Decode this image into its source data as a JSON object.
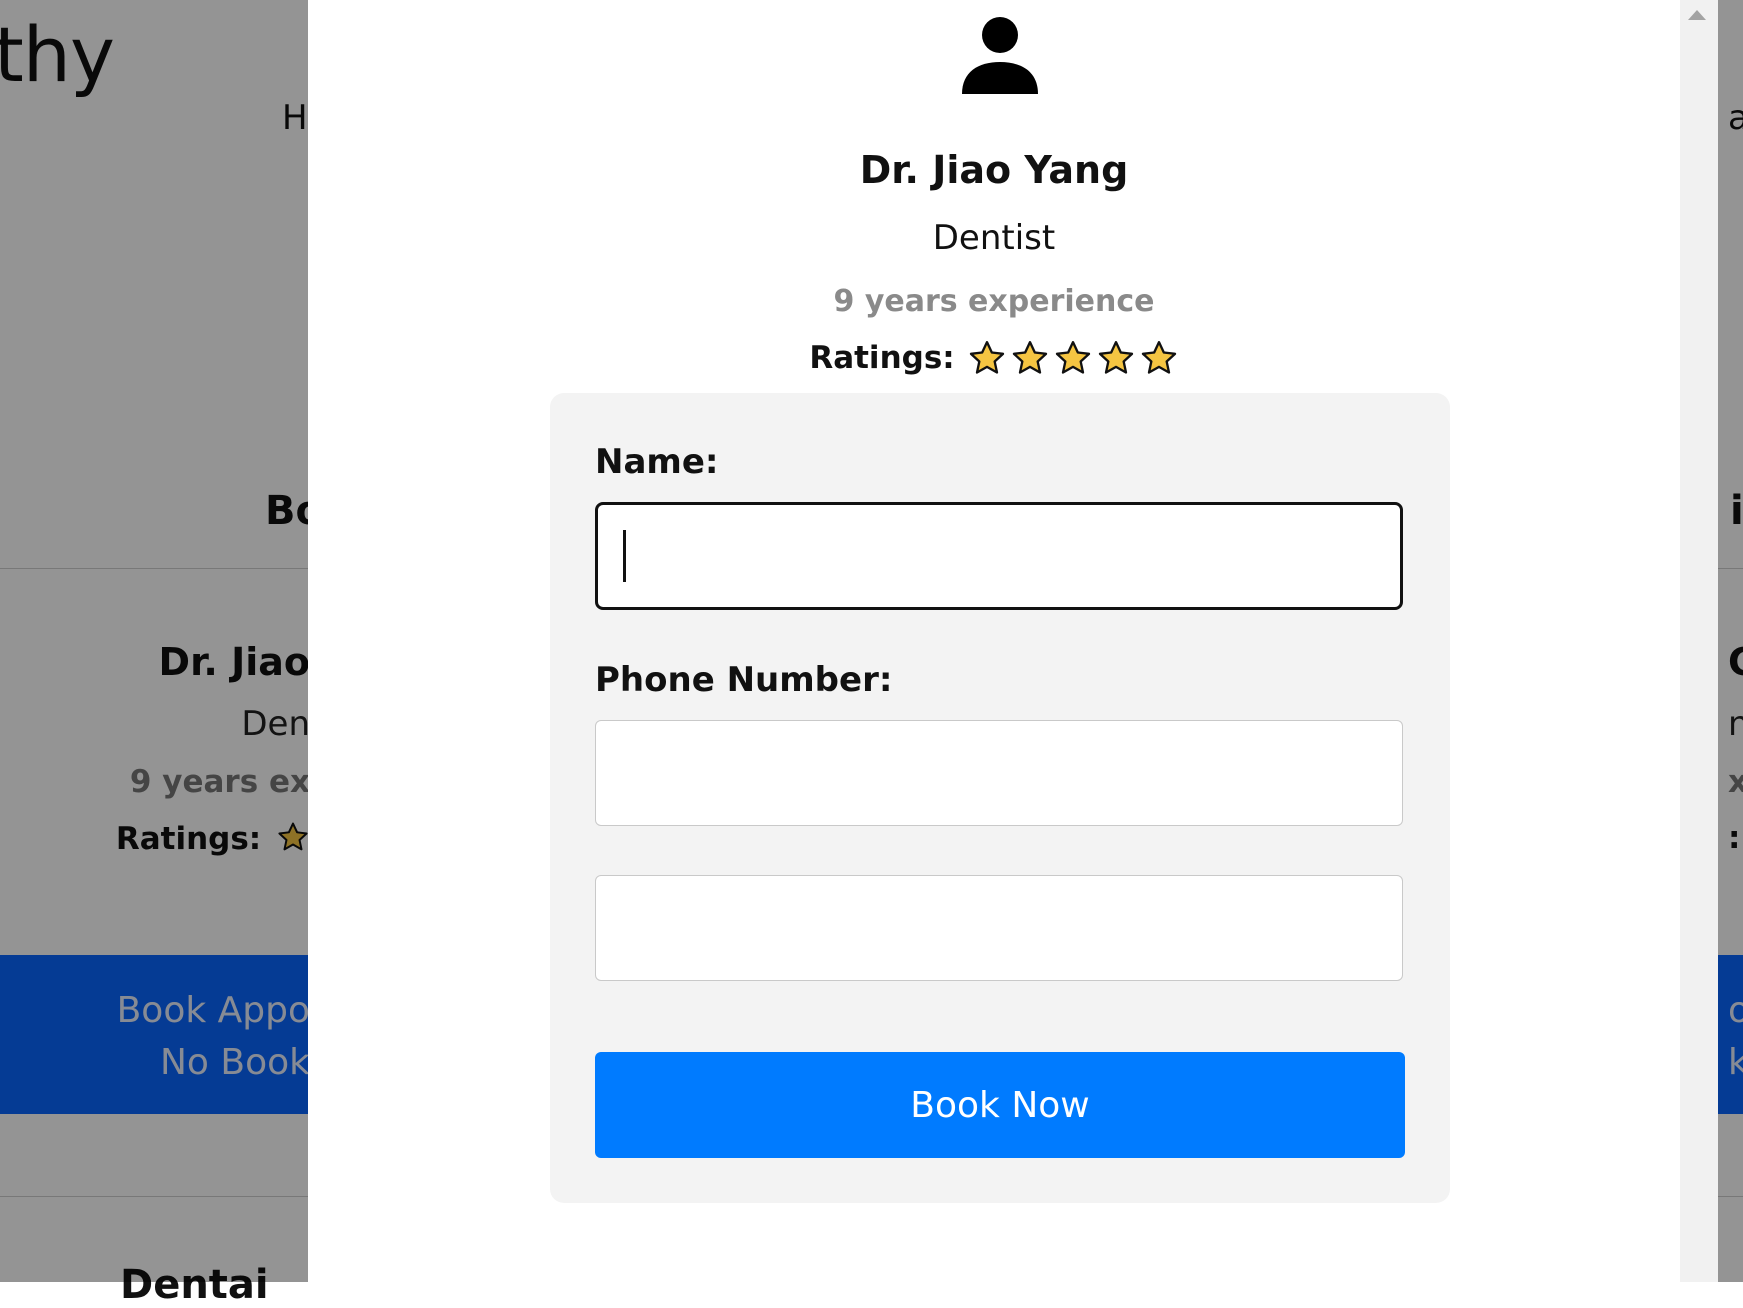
{
  "background_page": {
    "logo_fragment": "thy",
    "nav_left_fragment": "H",
    "nav_right_fragment": "a",
    "section_heading_left_fragment": "Bo",
    "section_heading_right_fragment": "il",
    "card_left": {
      "name_fragment": "Dr. Jiao",
      "specialty_fragment": "Den",
      "experience_fragment": "9 years ex",
      "ratings_fragment": "Ratings:",
      "book_line1_fragment": "Book Appo",
      "book_line2_fragment": "No Book"
    },
    "card_right": {
      "name_fragment": "C",
      "specialty_fragment": "n",
      "experience_fragment": "x",
      "ratings_fragment": ":",
      "book_line1_fragment": "o",
      "book_line2_fragment": "k"
    },
    "bottom_heading_fragment": "Dentai",
    "book_band_color": "#0a66ff"
  },
  "modal": {
    "doctor": {
      "name": "Dr. Jiao Yang",
      "specialty": "Dentist",
      "experience": "9 years experience",
      "ratings_label": "Ratings:",
      "rating_stars": 5
    },
    "form": {
      "name_label": "Name:",
      "name_value": "",
      "phone_label": "Phone Number:",
      "phone_value": "",
      "extra_value": "",
      "submit_label": "Book Now"
    }
  },
  "colors": {
    "primary_button": "#007bff",
    "star_fill": "#f5c542",
    "experience_text": "#8a8a8a"
  },
  "icons": [
    "user-profile-icon",
    "star-icon",
    "scroll-up-arrow-icon"
  ]
}
